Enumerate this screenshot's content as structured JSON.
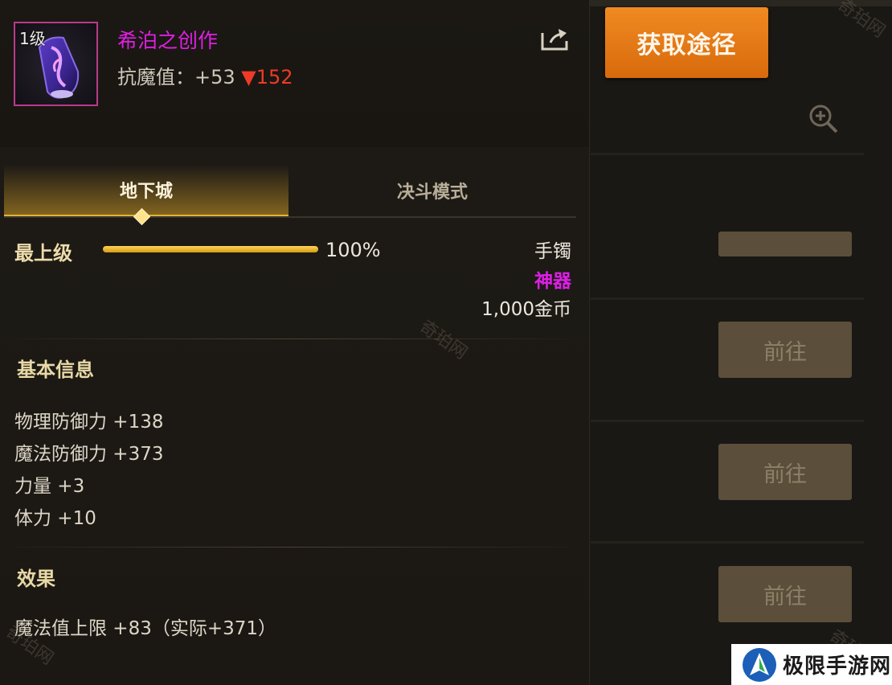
{
  "item": {
    "level": "1级",
    "name": "希泊之创作",
    "stat_label": "抗魔值：",
    "stat_value": "+53",
    "stat_delta": "▼152"
  },
  "tabs": [
    {
      "label": "地下城",
      "active": true
    },
    {
      "label": "决斗模式",
      "active": false
    }
  ],
  "grade": {
    "label": "最上级",
    "percent_text": "100%",
    "fill_fraction": 1.0
  },
  "item_info": {
    "type": "手镯",
    "rarity": "神器",
    "price": "1,000金币"
  },
  "basic_info": {
    "title": "基本信息",
    "stats": [
      "物理防御力 +138",
      "魔法防御力 +373",
      "力量 +3",
      "体力 +10"
    ]
  },
  "effects": {
    "title": "效果",
    "lines": [
      "魔法值上限 +83（实际+371）"
    ]
  },
  "side_panel": {
    "get_source_label": "获取途径",
    "goto_buttons": [
      "前往",
      "前往",
      "前往"
    ]
  },
  "watermark_text": "奇珀网",
  "site_logo_text": "极限手游网",
  "colors": {
    "rarity_purple": "#dd1fe6",
    "accent_orange": "#e97a18",
    "delta_red": "#f03a28",
    "gold_bar": "#e0b435"
  },
  "icons": [
    "share-icon",
    "zoom-in-icon",
    "item-bracelet-icon"
  ]
}
